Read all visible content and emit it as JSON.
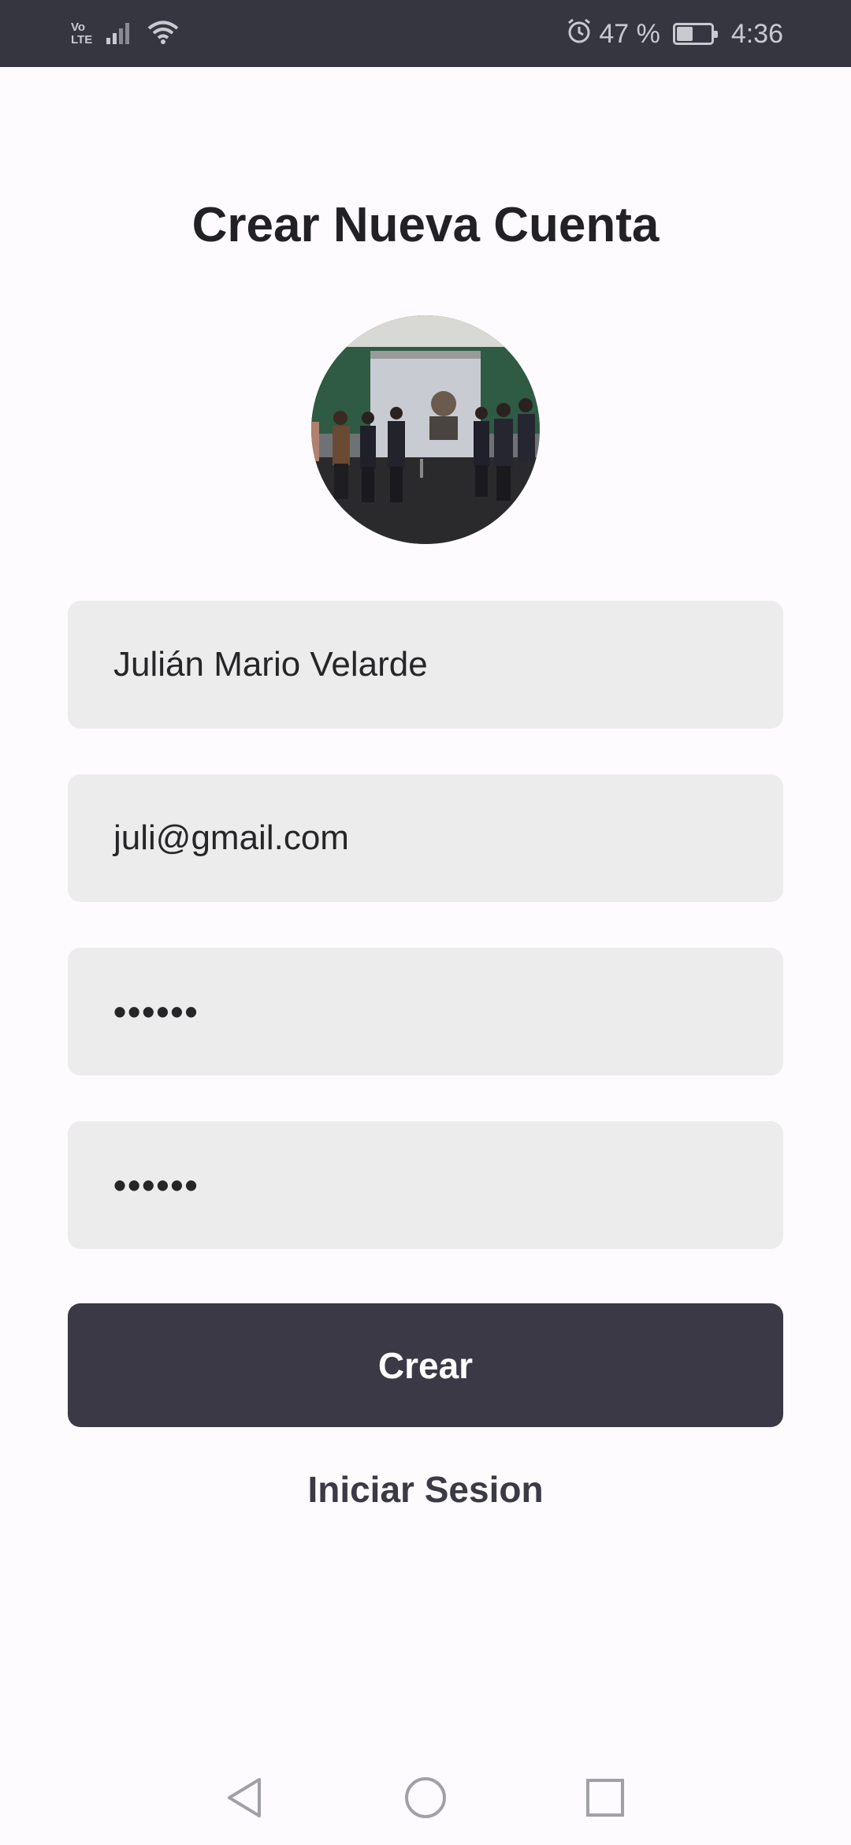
{
  "status_bar": {
    "network_top": "Vo",
    "network_bottom": "LTE",
    "battery_percent": "47 %",
    "battery_level": 0.47,
    "time": "4:36"
  },
  "title": "Crear Nueva Cuenta",
  "form": {
    "name_value": "Julián Mario Velarde",
    "email_value": "juli@gmail.com",
    "password_value": "••••••",
    "confirm_password_value": "••••••"
  },
  "buttons": {
    "create_label": "Crear",
    "login_link_label": "Iniciar Sesion"
  },
  "colors": {
    "status_bar": "#363640",
    "primary_button": "#3a3945",
    "field_background": "#ececec"
  }
}
